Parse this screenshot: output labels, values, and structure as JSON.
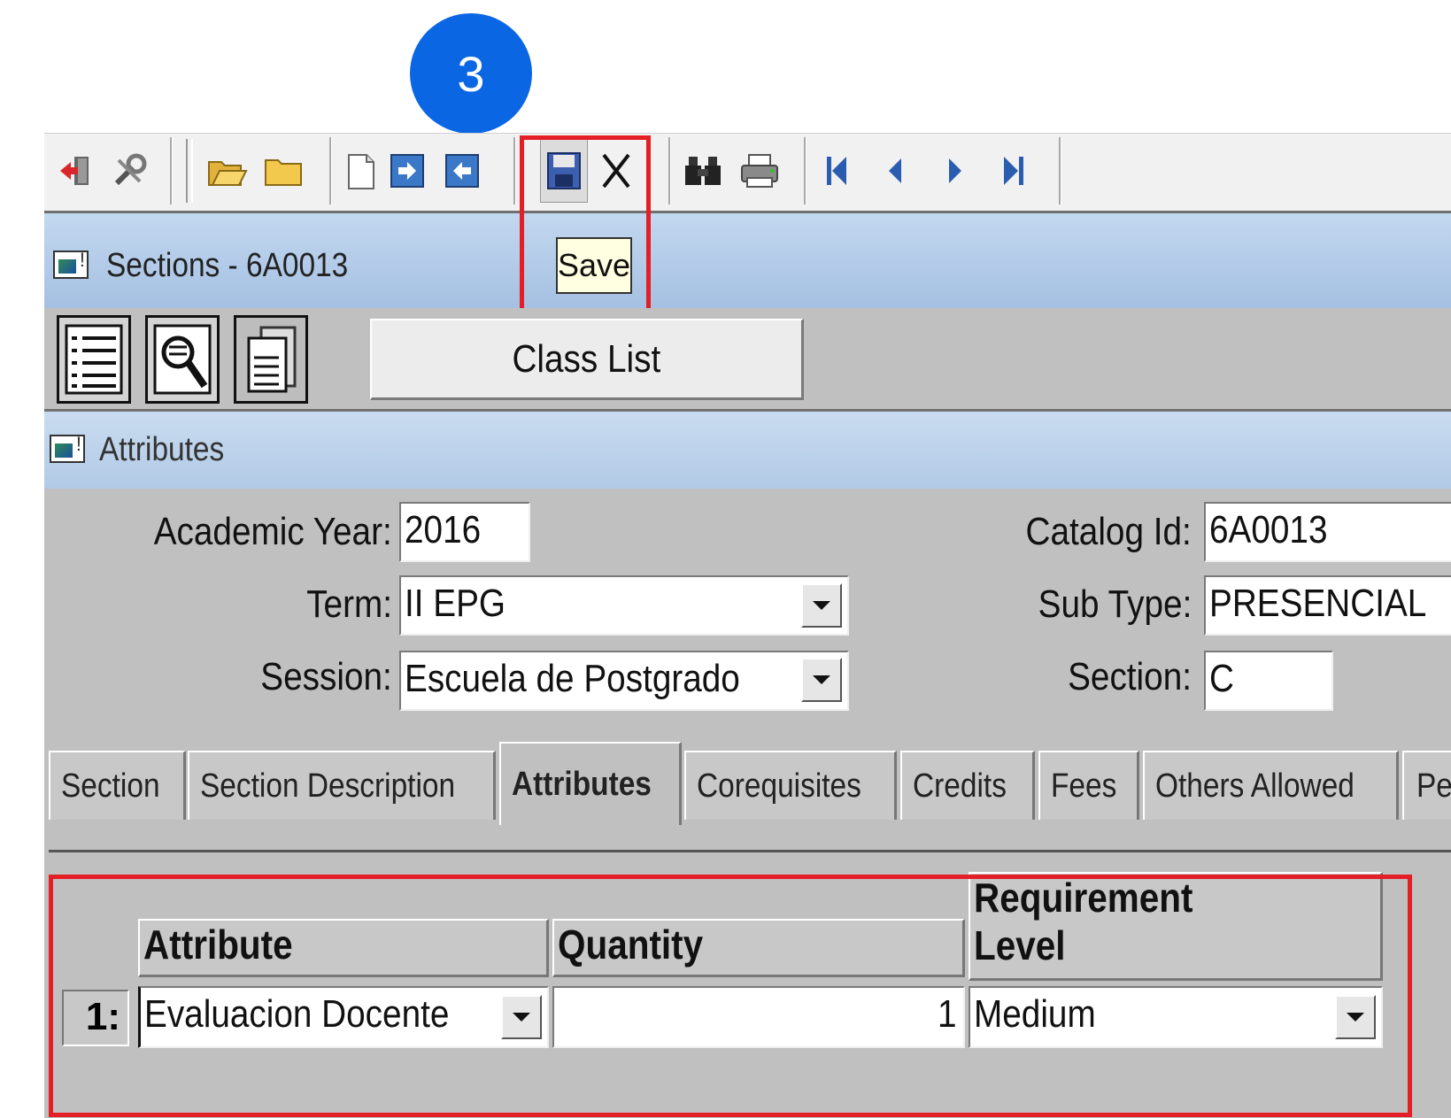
{
  "step": {
    "number": "3"
  },
  "toolbar": {
    "icons": [
      "exit-icon",
      "tools-icon",
      "open-folder-icon",
      "folder-icon",
      "new-document-icon",
      "next-record-icon",
      "previous-record-icon",
      "save-icon",
      "delete-icon",
      "find-icon",
      "print-icon",
      "first-record-icon",
      "previous-icon",
      "next-icon",
      "last-record-icon"
    ],
    "tooltip": "Save"
  },
  "window": {
    "title": "Sections -  6A0013"
  },
  "secondary_toolbar": {
    "class_list_label": "Class List"
  },
  "attributes_bar": {
    "title": "Attributes"
  },
  "form": {
    "academic_year": {
      "label": "Academic Year:",
      "value": "2016"
    },
    "term": {
      "label": "Term:",
      "value": "II EPG"
    },
    "session": {
      "label": "Session:",
      "value": "Escuela de Postgrado"
    },
    "catalog_id": {
      "label": "Catalog Id:",
      "value": "6A0013"
    },
    "sub_type": {
      "label": "Sub Type:",
      "value": "PRESENCIAL"
    },
    "section": {
      "label": "Section:",
      "value": "C"
    }
  },
  "tabs": [
    {
      "label": "Section"
    },
    {
      "label": "Section Description"
    },
    {
      "label": "Attributes",
      "active": true
    },
    {
      "label": "Corequisites"
    },
    {
      "label": "Credits"
    },
    {
      "label": "Fees"
    },
    {
      "label": "Others Allowed"
    },
    {
      "label": "Pe"
    }
  ],
  "grid": {
    "headers": {
      "attribute": "Attribute",
      "quantity": "Quantity",
      "requirement_line1": "Requirement",
      "requirement_line2": "Level"
    },
    "rows": [
      {
        "num": "1:",
        "attribute": "Evaluacion Docente",
        "quantity": "1",
        "requirement_level": "Medium"
      }
    ]
  },
  "colors": {
    "highlight": "#e31e24",
    "badge": "#0b66e4",
    "tooltip_bg": "#ffffe1"
  }
}
